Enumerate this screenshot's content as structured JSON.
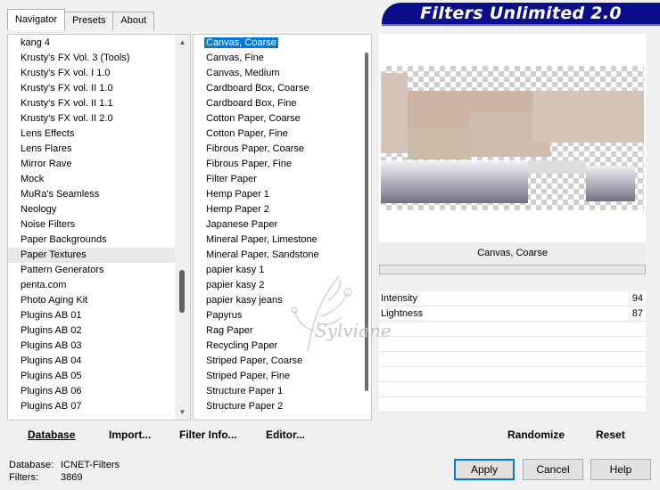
{
  "tabs": [
    "Navigator",
    "Presets",
    "About"
  ],
  "title": "Filters Unlimited 2.0",
  "categories": [
    "kang 4",
    "Krusty's FX Vol. 3 (Tools)",
    "Krusty's FX vol. I 1.0",
    "Krusty's FX vol. II 1.0",
    "Krusty's FX vol. II 1.1",
    "Krusty's FX vol. II 2.0",
    "Lens Effects",
    "Lens Flares",
    "Mirror Rave",
    "Mock",
    "MuRa's Seamless",
    "Neology",
    "Noise Filters",
    "Paper Backgrounds",
    "Paper Textures",
    "Pattern Generators",
    "penta.com",
    "Photo Aging Kit",
    "Plugins AB 01",
    "Plugins AB 02",
    "Plugins AB 03",
    "Plugins AB 04",
    "Plugins AB 05",
    "Plugins AB 06",
    "Plugins AB 07"
  ],
  "filters": [
    "Canvas, Coarse",
    "Canvas, Fine",
    "Canvas, Medium",
    "Cardboard Box, Coarse",
    "Cardboard Box, Fine",
    "Cotton Paper, Coarse",
    "Cotton Paper, Fine",
    "Fibrous Paper, Coarse",
    "Fibrous Paper, Fine",
    "Filter Paper",
    "Hemp Paper 1",
    "Hemp Paper 2",
    "Japanese Paper",
    "Mineral Paper, Limestone",
    "Mineral Paper, Sandstone",
    "papier kasy 1",
    "papier kasy 2",
    "papier kasy jeans",
    "Papyrus",
    "Rag Paper",
    "Recycling Paper",
    "Striped Paper, Coarse",
    "Striped Paper, Fine",
    "Structure Paper 1",
    "Structure Paper 2"
  ],
  "selected_filter": "Canvas, Coarse",
  "params": [
    {
      "label": "Intensity",
      "value": "94"
    },
    {
      "label": "Lightness",
      "value": "87"
    }
  ],
  "buttons": {
    "database": "Database",
    "import": "Import...",
    "filter_info": "Filter Info...",
    "editor": "Editor...",
    "randomize": "Randomize",
    "reset": "Reset",
    "apply": "Apply",
    "cancel": "Cancel",
    "help": "Help"
  },
  "footer": {
    "database_label": "Database:",
    "database_value": "ICNET-Filters",
    "filters_label": "Filters:",
    "filters_value": "3869"
  },
  "watermark_text": "Sylviane"
}
